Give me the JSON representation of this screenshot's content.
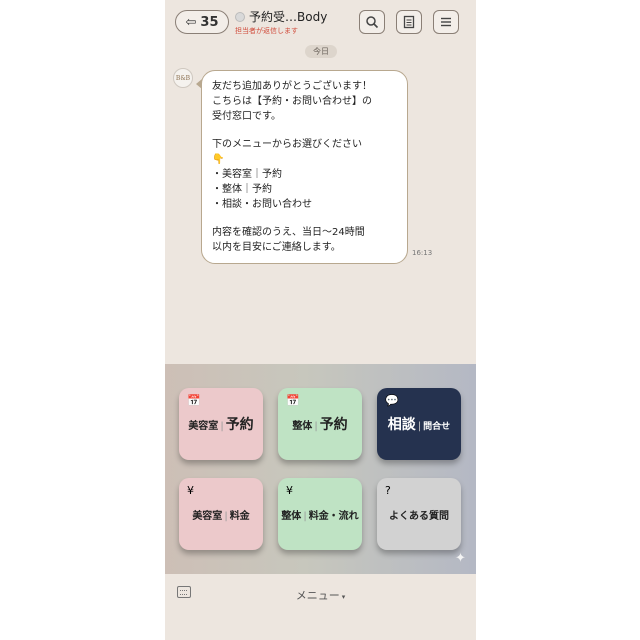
{
  "header": {
    "back_count": "35",
    "title": "予約受…Body",
    "subtitle": "担当者が返信します"
  },
  "chat": {
    "date_label": "今日",
    "avatar_text": "B&B",
    "message_lines": [
      "友だち追加ありがとうございます！",
      "こちらは【予約・お問い合わせ】の",
      "受付窓口です。",
      "",
      "下のメニューからお選びください",
      "👇",
      "・美容室｜予約",
      "・整体｜予約",
      "・相談・お問い合わせ",
      "",
      "内容を確認のうえ、当日〜24時間",
      "以内を目安にご連絡します。"
    ],
    "time": "16:13"
  },
  "rich_menu": {
    "tiles": [
      {
        "icon": "calendar-icon",
        "a": "美容室",
        "b": "予約"
      },
      {
        "icon": "calendar-icon",
        "a": "整体",
        "b": "予約"
      },
      {
        "icon": "chat-bubble-icon",
        "a": "相談",
        "b": "問合せ"
      },
      {
        "icon": "yen-icon",
        "a": "美容室",
        "b": "料金"
      },
      {
        "icon": "yen-icon",
        "a": "整体",
        "b": "料金・流れ"
      },
      {
        "icon": "question-icon",
        "a": "よくある質問",
        "b": ""
      }
    ],
    "icons": {
      "calendar": "📅",
      "chat": "💬",
      "yen": "¥",
      "question": "?",
      "sparkle": "✦"
    }
  },
  "footer": {
    "menu_label": "メニュー",
    "caret": "▾"
  },
  "colors": {
    "pink": "#ecc9cb",
    "green": "#bfe3c4",
    "navy": "#25324f",
    "gray": "#d2d2d2",
    "background": "#ede6df"
  }
}
